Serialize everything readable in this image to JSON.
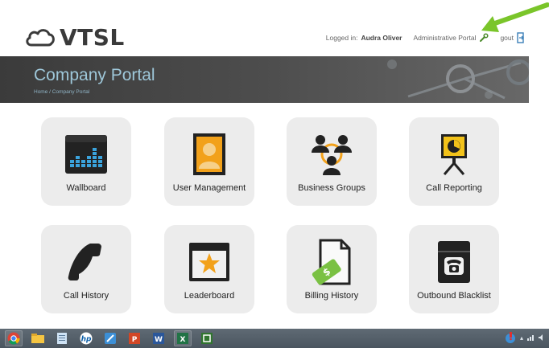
{
  "header": {
    "logo_text": "VTSL",
    "logged_in_prefix": "Logged in:",
    "user_name": "Audra Oliver",
    "admin_portal_label": "Administrative Portal",
    "logout_label": "gout"
  },
  "banner": {
    "title": "Company Portal",
    "breadcrumb": "Home / Company Portal"
  },
  "tiles": [
    {
      "label": "Wallboard",
      "icon": "wallboard-icon"
    },
    {
      "label": "User Management",
      "icon": "user-management-icon"
    },
    {
      "label": "Business Groups",
      "icon": "business-groups-icon"
    },
    {
      "label": "Call Reporting",
      "icon": "call-reporting-icon"
    },
    {
      "label": "Call History",
      "icon": "phone-handset-icon"
    },
    {
      "label": "Leaderboard",
      "icon": "leaderboard-star-icon"
    },
    {
      "label": "Billing History",
      "icon": "billing-history-icon"
    },
    {
      "label": "Outbound Blacklist",
      "icon": "outbound-blacklist-icon"
    }
  ],
  "taskbar": {
    "apps": [
      "chrome-icon",
      "file-explorer-icon",
      "notepad-icon",
      "hp-icon",
      "snipping-tool-icon",
      "powerpoint-icon",
      "word-icon",
      "excel-icon",
      "project-icon"
    ]
  },
  "colors": {
    "banner_title": "#9ec7d9",
    "tile_bg": "#ececec",
    "accent_orange": "#f2a11a",
    "accent_green": "#7ac143",
    "annotation_green": "#7ac52a"
  }
}
